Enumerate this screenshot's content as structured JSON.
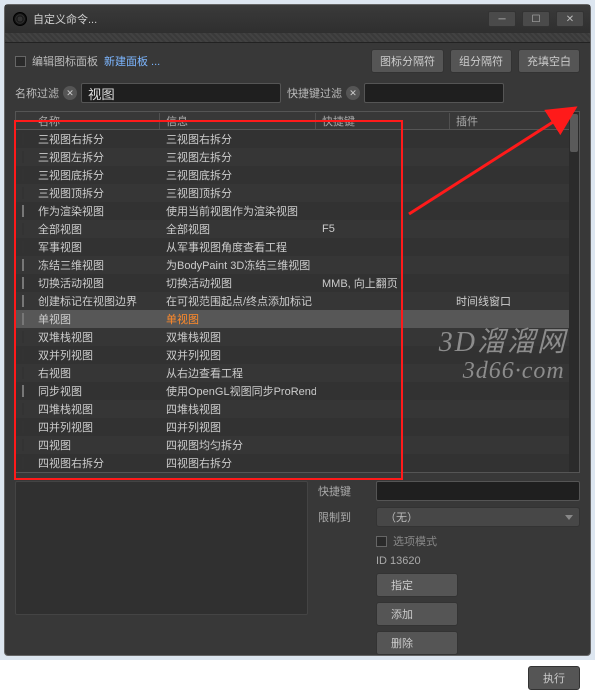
{
  "window": {
    "title": "自定义命令..."
  },
  "toolbar": {
    "edit_icon_palette": "编辑图标面板",
    "new_panel": "新建面板 ...",
    "icon_sep": "图标分隔符",
    "group_sep": "组分隔符",
    "fill_blank": "充填空白"
  },
  "filters": {
    "name_label": "名称过滤",
    "name_value": "视图",
    "shortcut_label": "快捷键过滤",
    "shortcut_value": ""
  },
  "columns": {
    "name": "名称",
    "info": "信息",
    "shortcut": "快捷键",
    "plugin": "插件"
  },
  "rows": [
    {
      "icon": "i1",
      "name": "三视图右拆分",
      "info": "三视图右拆分",
      "shortcut": "",
      "plugin": "",
      "sel": false
    },
    {
      "icon": "i1",
      "name": "三视图左拆分",
      "info": "三视图左拆分",
      "shortcut": "",
      "plugin": "",
      "sel": false
    },
    {
      "icon": "i1",
      "name": "三视图底拆分",
      "info": "三视图底拆分",
      "shortcut": "",
      "plugin": "",
      "sel": false
    },
    {
      "icon": "i1",
      "name": "三视图顶拆分",
      "info": "三视图顶拆分",
      "shortcut": "",
      "plugin": "",
      "sel": false
    },
    {
      "icon": "i3",
      "name": "作为渲染视图",
      "info": "使用当前视图作为渲染视图",
      "shortcut": "",
      "plugin": "",
      "sel": false
    },
    {
      "icon": "i2",
      "name": "全部视图",
      "info": "全部视图",
      "shortcut": "F5",
      "plugin": "",
      "sel": false
    },
    {
      "icon": "i5",
      "name": "军事视图",
      "info": "从军事视图角度查看工程",
      "shortcut": "",
      "plugin": "",
      "sel": false
    },
    {
      "icon": "i4",
      "name": "冻结三维视图",
      "info": "为BodyPaint 3D冻结三维视图",
      "shortcut": "",
      "plugin": "",
      "sel": false
    },
    {
      "icon": "i3",
      "name": "切换活动视图",
      "info": "切换活动视图",
      "shortcut": "MMB, 向上翻页",
      "plugin": "",
      "sel": false
    },
    {
      "icon": "i3",
      "name": "创建标记在视图边界",
      "info": "在可视范围起点/终点添加标记",
      "shortcut": "",
      "plugin": "时间线窗口",
      "sel": false
    },
    {
      "icon": "i3",
      "name": "单视图",
      "info": "单视图",
      "info_orange": true,
      "shortcut": "",
      "plugin": "",
      "sel": true
    },
    {
      "icon": "i1",
      "name": "双堆栈视图",
      "info": "双堆栈视图",
      "shortcut": "",
      "plugin": "",
      "sel": false
    },
    {
      "icon": "i1",
      "name": "双并列视图",
      "info": "双并列视图",
      "shortcut": "",
      "plugin": "",
      "sel": false
    },
    {
      "icon": "i5",
      "name": "右视图",
      "info": "从右边查看工程",
      "shortcut": "",
      "plugin": "",
      "sel": false
    },
    {
      "icon": "i4",
      "name": "同步视图",
      "info": "使用OpenGL视图同步ProRend",
      "shortcut": "",
      "plugin": "",
      "sel": false
    },
    {
      "icon": "i1",
      "name": "四堆栈视图",
      "info": "四堆栈视图",
      "shortcut": "",
      "plugin": "",
      "sel": false
    },
    {
      "icon": "i1",
      "name": "四并列视图",
      "info": "四并列视图",
      "shortcut": "",
      "plugin": "",
      "sel": false
    },
    {
      "icon": "i1",
      "name": "四视图",
      "info": "四视图均匀拆分",
      "shortcut": "",
      "plugin": "",
      "sel": false
    },
    {
      "icon": "i1",
      "name": "四视图右拆分",
      "info": "四视图右拆分",
      "shortcut": "",
      "plugin": "",
      "sel": false
    }
  ],
  "form": {
    "shortcut_label": "快捷键",
    "shortcut_value": "",
    "limit_label": "限制到",
    "limit_value": "（无）",
    "option_mode": "选项模式",
    "id_text": "ID 13620",
    "assign": "指定",
    "add": "添加",
    "delete": "删除",
    "execute": "执行"
  },
  "watermark": {
    "line1": "3D溜溜网",
    "line2": "3d66·com"
  }
}
